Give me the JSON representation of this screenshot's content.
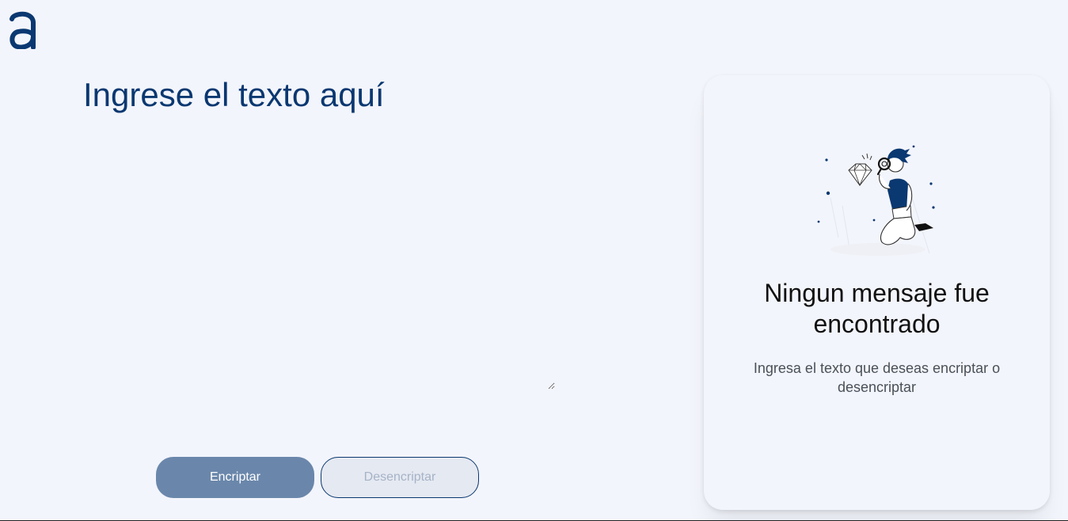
{
  "header": {
    "logo_icon": "alura-a-logo-icon"
  },
  "editor": {
    "placeholder": "Ingrese el texto aquí",
    "value": ""
  },
  "actions": {
    "encrypt_label": "Encriptar",
    "decrypt_label": "Desencriptar"
  },
  "result_panel": {
    "illustration_icon": "person-with-magnifier-and-diamond-illustration",
    "title": "Ningun mensaje fue encontrado",
    "subtitle": "Ingresa el texto que deseas encriptar o desencriptar"
  },
  "colors": {
    "background": "#f3f5fc",
    "brand": "#0a3871",
    "encrypt_button": "#6a87ab",
    "decrypt_button": "#e5e9f1"
  }
}
